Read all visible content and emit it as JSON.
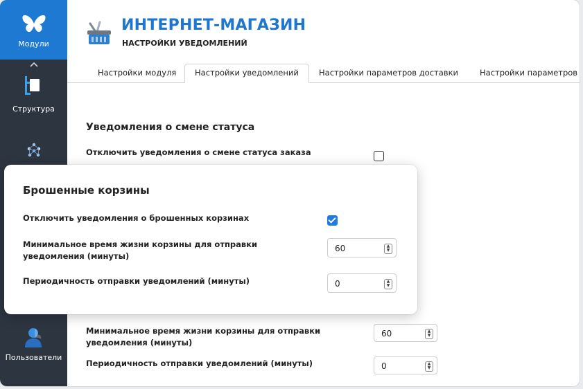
{
  "sidebar": {
    "modules_label": "Модули",
    "structure_label": "Структура",
    "users_label": "Пользователи",
    "active_color": "#1d79d2",
    "bg_color": "#2d3541"
  },
  "header": {
    "title": "ИНТЕРНЕТ-МАГАЗИН",
    "subtitle": "НАСТРОЙКИ УВЕДОМЛЕНИЙ",
    "title_color": "#1e76d0"
  },
  "tabs": [
    {
      "label": "Настройки модуля",
      "active": false
    },
    {
      "label": "Настройки уведомлений",
      "active": true
    },
    {
      "label": "Настройки параметров доставки",
      "active": false
    },
    {
      "label": "Настройки параметров о",
      "active": false
    }
  ],
  "status_section": {
    "title": "Уведомления о смене статуса",
    "disable_label": "Отключить уведомления о смене статуса заказа",
    "disable_checked": false
  },
  "background_cart": {
    "min_time_label_line1": "Минимальное время жизни корзины для отправки",
    "min_time_label_line2": "уведомления (минуты)",
    "min_time_value": "60",
    "period_label": "Периодичность отправки уведомлений (минуты)",
    "period_value": "0"
  },
  "popup": {
    "title": "Брошенные корзины",
    "disable_label": "Отключить уведомления о брошенных корзинах",
    "disable_checked": true,
    "min_time_label_line1": "Минимальное время жизни корзины для отправки",
    "min_time_label_line2": "уведомления (минуты)",
    "min_time_value": "60",
    "period_label": "Периодичность отправки уведомлений (минуты)",
    "period_value": "0"
  }
}
